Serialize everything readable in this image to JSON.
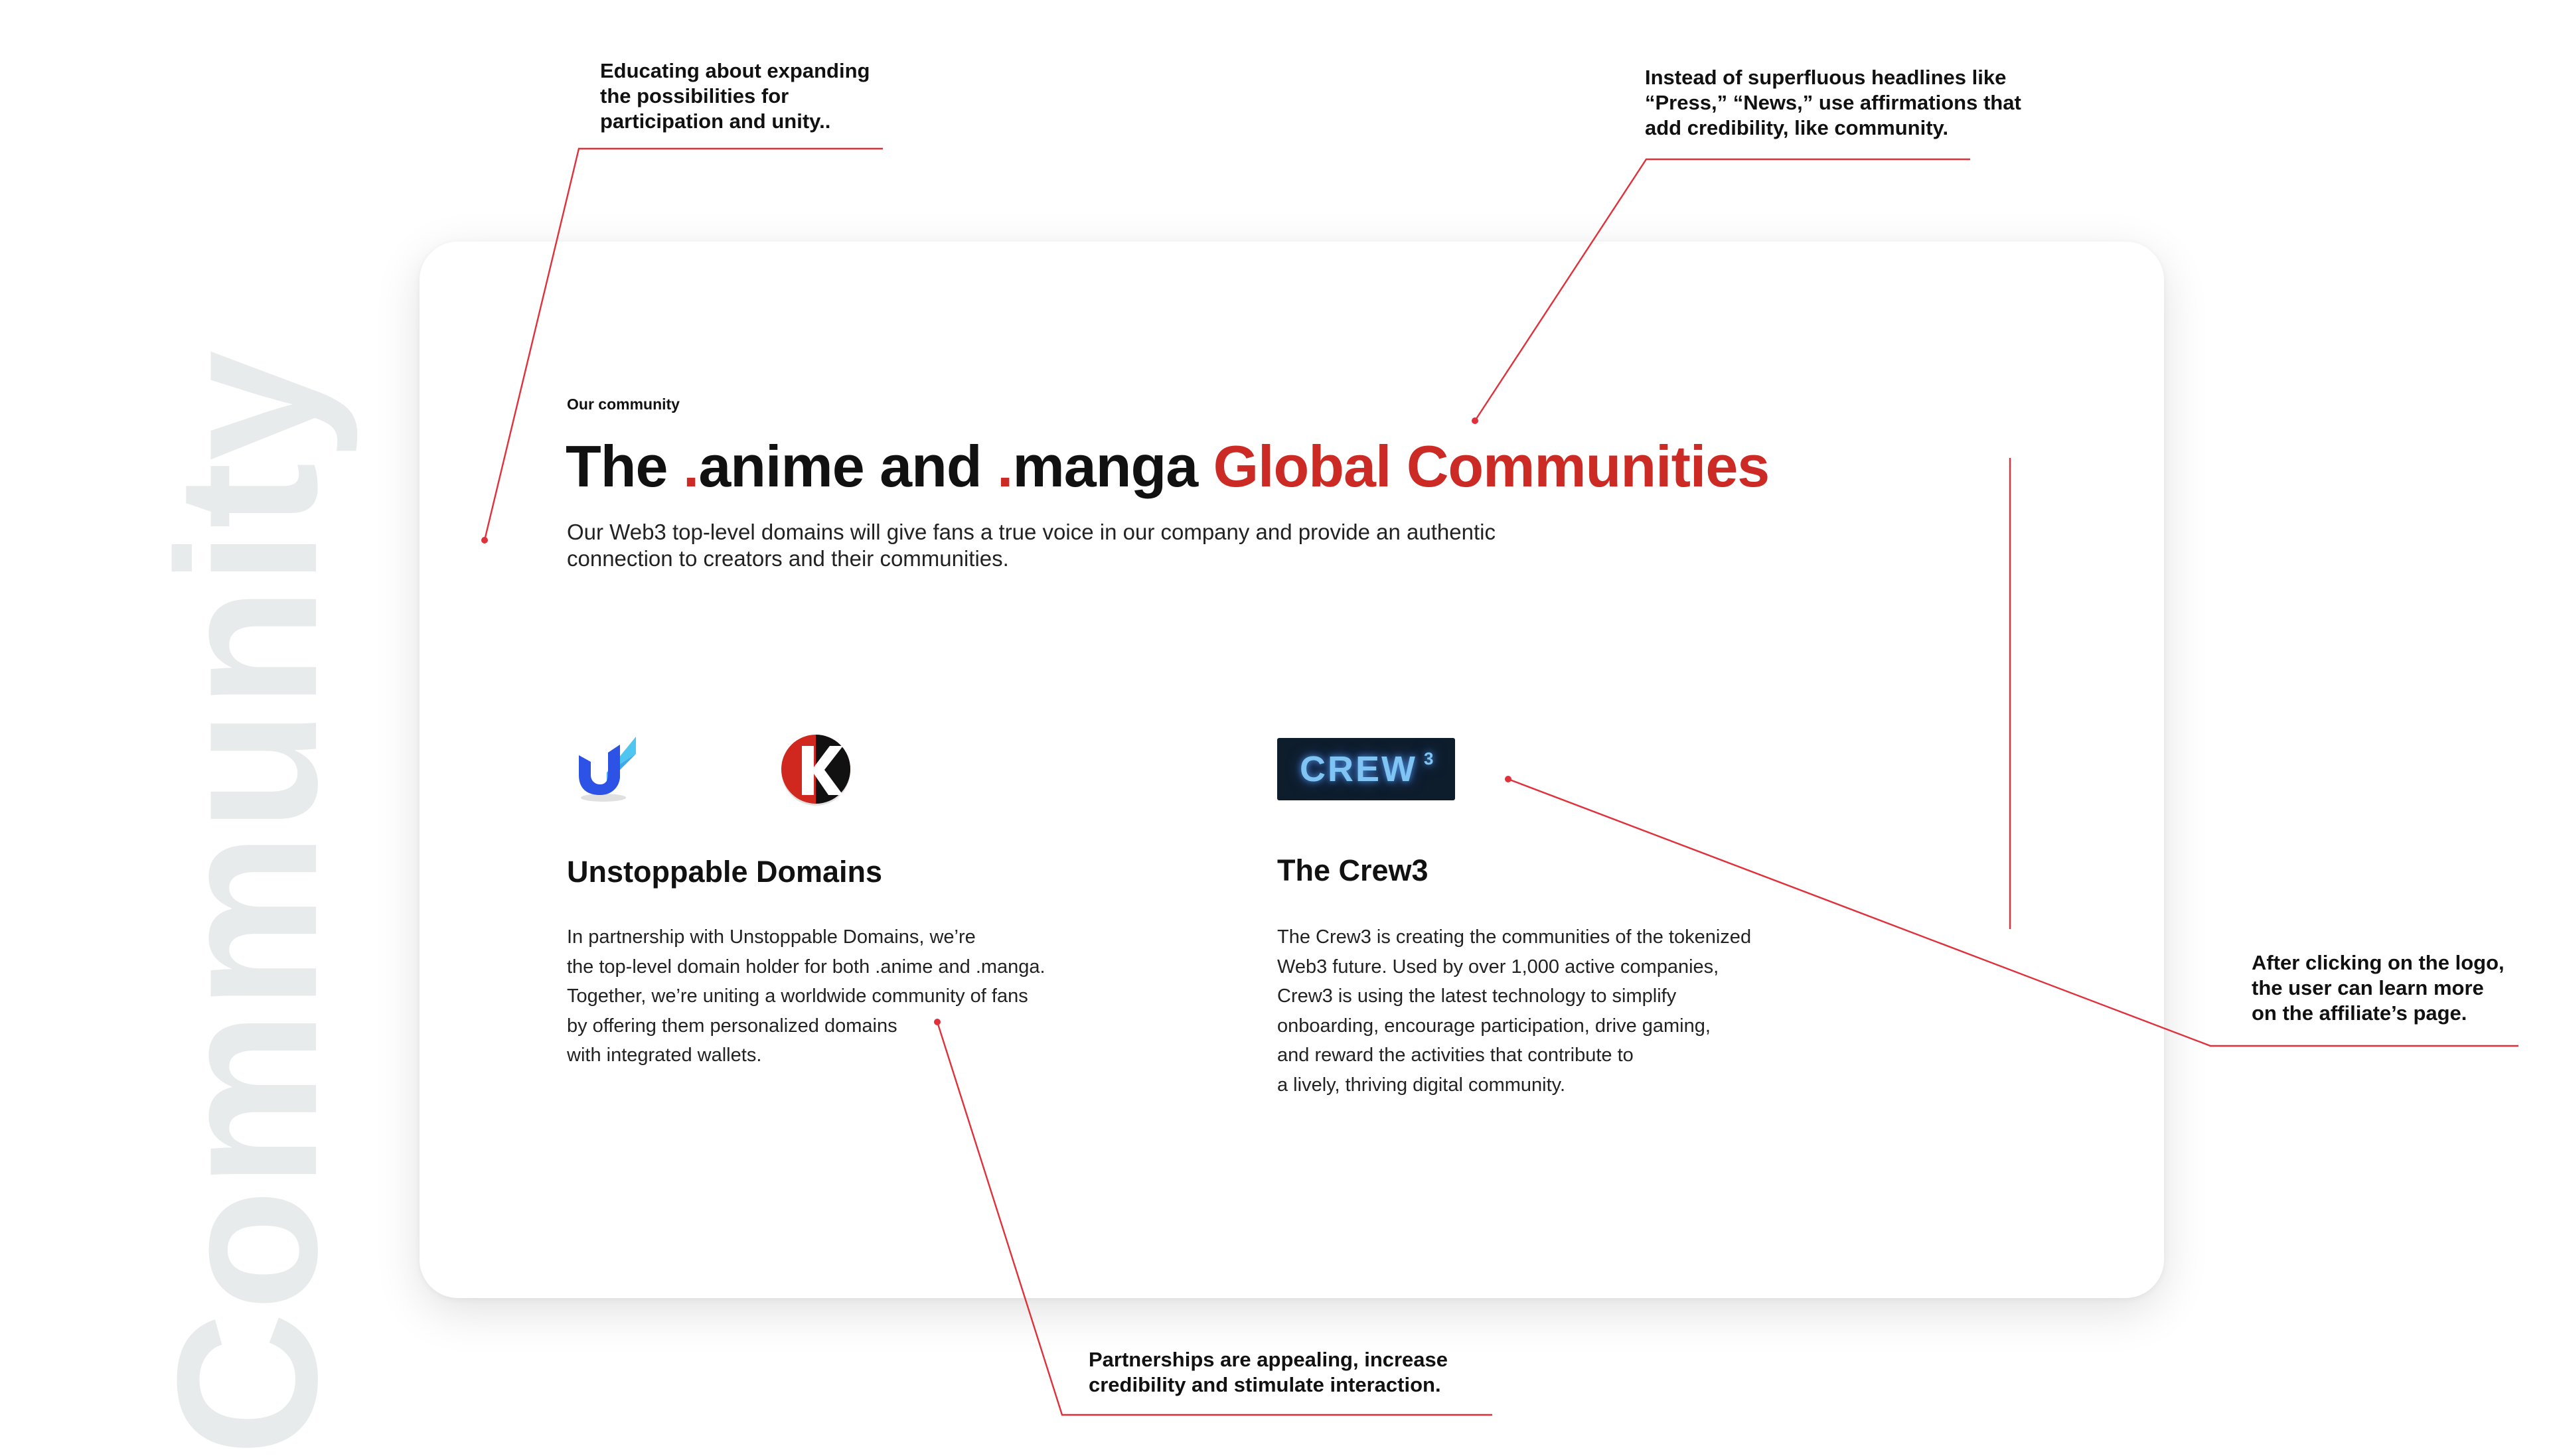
{
  "watermark": "Community",
  "card": {
    "eyebrow": "Our community",
    "headline": {
      "part1": "The ",
      "dot1": ".",
      "part2": "anime and ",
      "dot2": ".",
      "part3": "manga ",
      "highlight": "Global Communities"
    },
    "lead": "Our Web3 top-level domains will give fans a true voice in our company and provide an authentic connection to creators and their communities.",
    "partners": [
      {
        "name": "Unstoppable Domains",
        "logos": [
          "unstoppable-domains-logo",
          "k-logo"
        ],
        "body": "In partnership with Unstoppable Domains, we’re\nthe top-level domain holder for both .anime and .manga.\nTogether, we’re uniting a worldwide community of fans\nby offering them personalized domains\nwith integrated wallets."
      },
      {
        "name": "The Crew3",
        "logo_text": "CREW",
        "logo_sup": "3",
        "body": "The Crew3 is creating the communities of the tokenized\nWeb3 future. Used by over 1,000 active companies,\nCrew3 is using the latest technology to simplify\nonboarding, encourage participation, drive gaming,\nand reward the activities that contribute to\na lively, thriving digital community."
      }
    ]
  },
  "annotations": {
    "top_left": "Educating about expanding\nthe possibilities for\nparticipation and unity..",
    "top_right": "Instead of superfluous headlines like\n“Press,” “News,” use affirmations that\nadd credibility, like community.",
    "right": "After clicking on the logo,\nthe user can learn more\non the affiliate’s page.",
    "bottom": "Partnerships are appealing, increase\ncredibility and stimulate interaction."
  },
  "colors": {
    "accent": "#cc2a24",
    "annotation_line": "#e0303a",
    "watermark": "#e8ebec"
  }
}
